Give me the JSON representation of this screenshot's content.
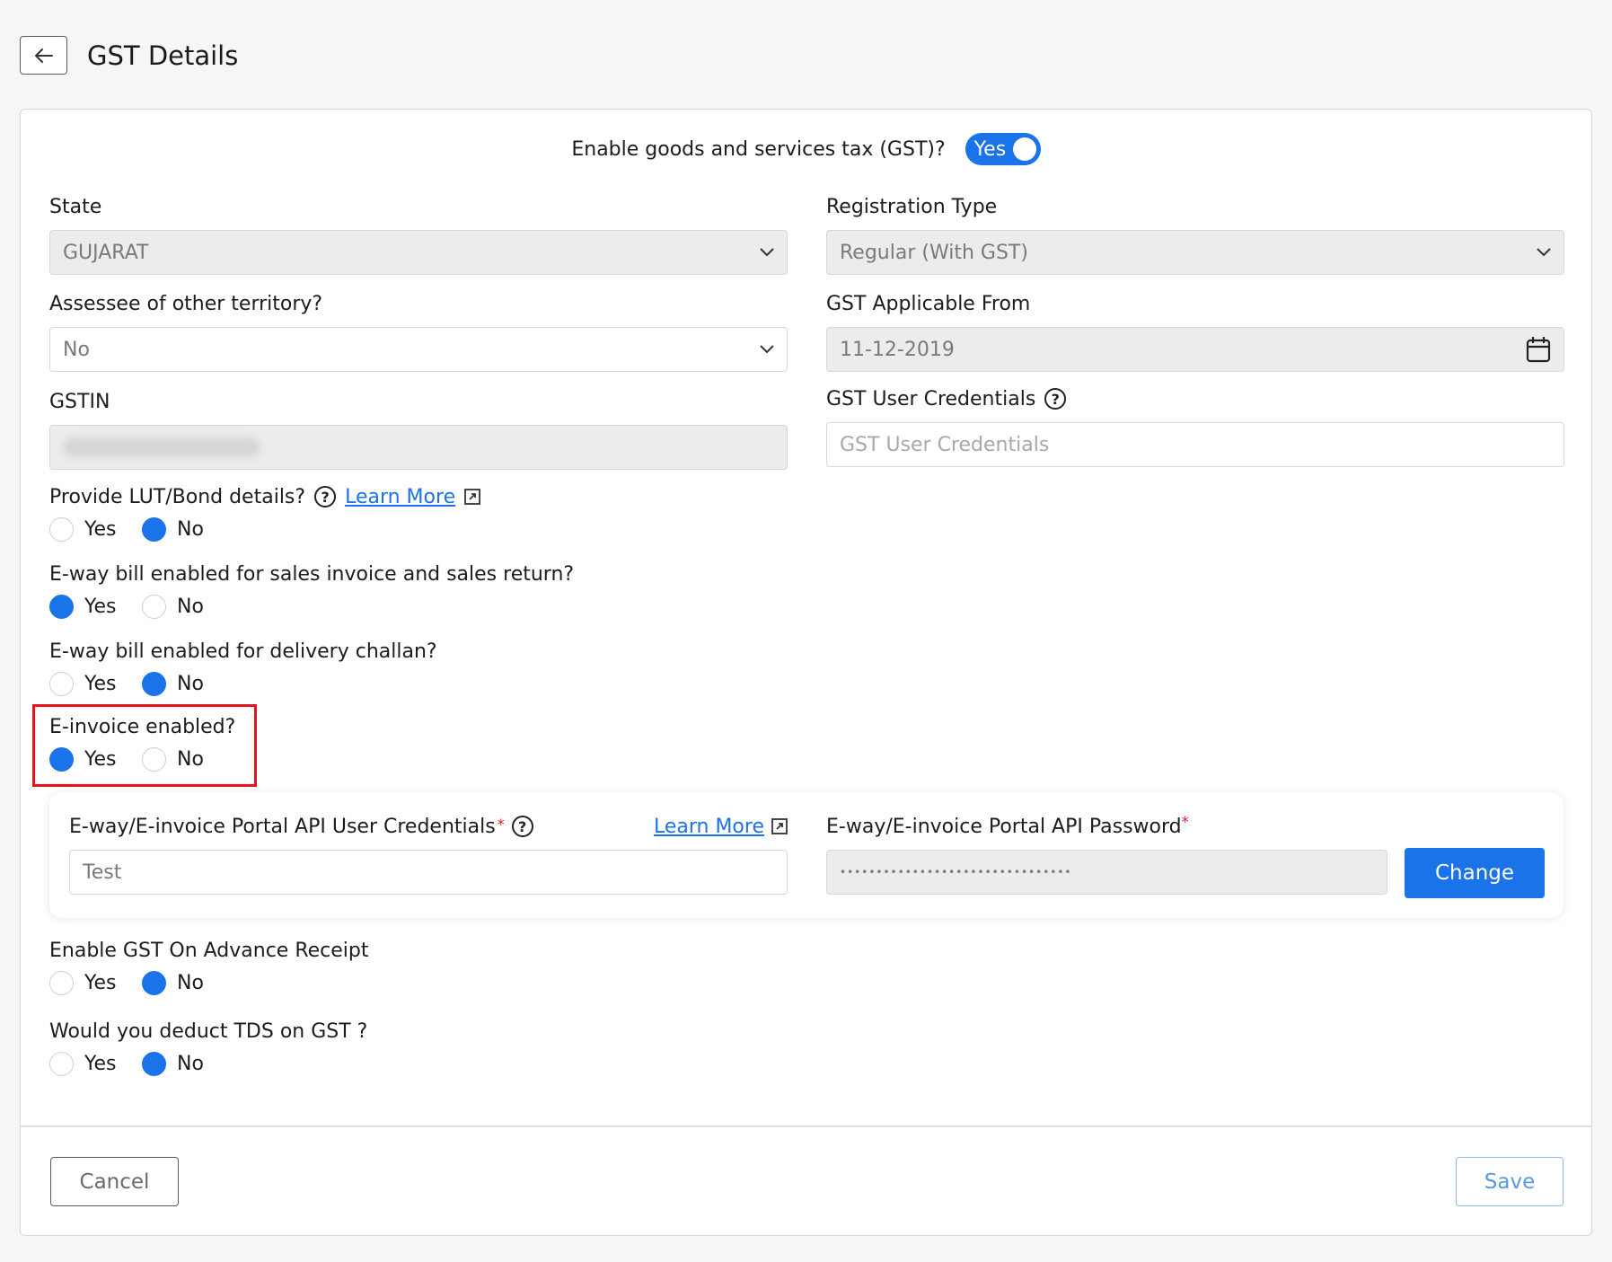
{
  "header": {
    "title": "GST Details"
  },
  "gst_toggle": {
    "label": "Enable goods and services tax (GST)?",
    "value": "Yes"
  },
  "state": {
    "label": "State",
    "value": "GUJARAT"
  },
  "registration_type": {
    "label": "Registration Type",
    "value": "Regular (With GST)"
  },
  "assessee": {
    "label": "Assessee of other territory?",
    "value": "No"
  },
  "gst_applicable": {
    "label": "GST Applicable From",
    "value": "11-12-2019"
  },
  "gstin": {
    "label": "GSTIN"
  },
  "gst_credentials": {
    "label": "GST User Credentials",
    "placeholder": "GST User Credentials"
  },
  "lut": {
    "label": "Provide LUT/Bond details?",
    "learn_more": "Learn More",
    "yes": "Yes",
    "no": "No",
    "selected": "No"
  },
  "eway_sales": {
    "label": "E-way bill enabled for sales invoice and sales return?",
    "yes": "Yes",
    "no": "No",
    "selected": "Yes"
  },
  "eway_challan": {
    "label": "E-way bill enabled for delivery challan?",
    "yes": "Yes",
    "no": "No",
    "selected": "No"
  },
  "einvoice": {
    "label": "E-invoice enabled?",
    "yes": "Yes",
    "no": "No",
    "selected": "Yes"
  },
  "portal": {
    "user_label": "E-way/E-invoice Portal API User Credentials",
    "required_mark": "*",
    "learn_more": "Learn More",
    "user_value": "Test",
    "password_label": "E-way/E-invoice Portal API Password",
    "password_value": "••••••••••••••••••••••••••••••••",
    "change_label": "Change"
  },
  "advance_receipt": {
    "label": "Enable GST On Advance Receipt",
    "yes": "Yes",
    "no": "No",
    "selected": "No"
  },
  "tds": {
    "label": "Would you deduct TDS on GST ?",
    "yes": "Yes",
    "no": "No",
    "selected": "No"
  },
  "footer": {
    "cancel_label": "Cancel",
    "save_label": "Save"
  },
  "colors": {
    "accent": "#1a73e8",
    "highlight": "#e8121c"
  }
}
